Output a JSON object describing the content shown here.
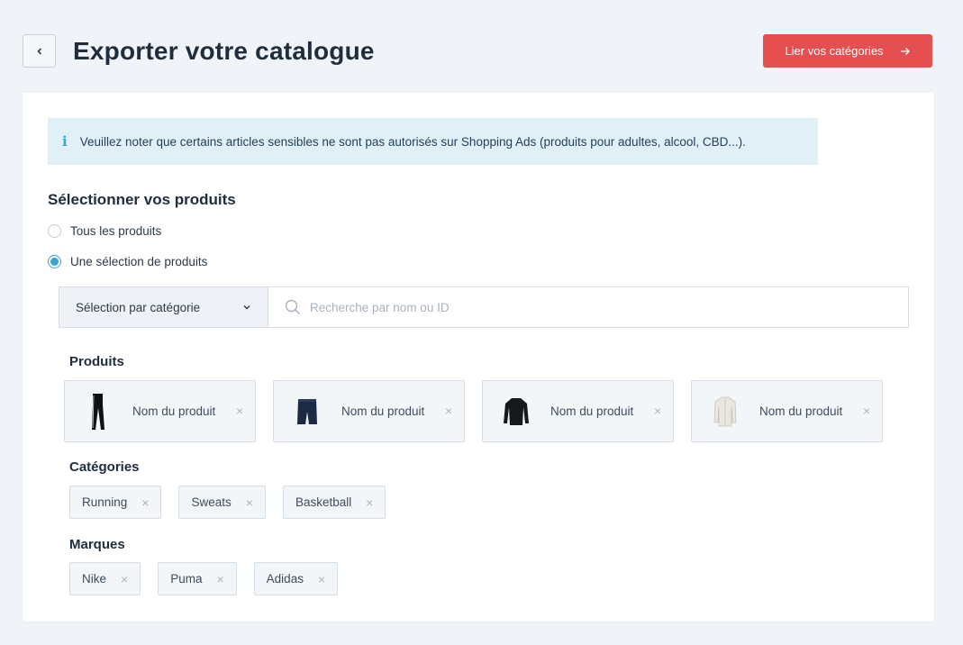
{
  "header": {
    "title": "Exporter votre catalogue",
    "primary_button": "Lier vos catégories"
  },
  "info": {
    "text": "Veuillez noter que certains articles sensibles ne sont pas autorisés sur Shopping Ads (produits pour adultes, alcool, CBD...)."
  },
  "selection": {
    "title": "Sélectionner vos produits",
    "options": [
      {
        "label": "Tous les produits",
        "checked": false
      },
      {
        "label": "Une sélection de produits",
        "checked": true
      }
    ]
  },
  "filter": {
    "select_value": "Sélection par catégorie",
    "search_placeholder": "Recherche par nom ou ID"
  },
  "products": {
    "title": "Produits",
    "items": [
      {
        "name": "Nom du produit",
        "image": "leggings"
      },
      {
        "name": "Nom du produit",
        "image": "shorts"
      },
      {
        "name": "Nom du produit",
        "image": "long-sleeve-top"
      },
      {
        "name": "Nom du produit",
        "image": "jacket"
      }
    ]
  },
  "categories": {
    "title": "Catégories",
    "items": [
      "Running",
      "Sweats",
      "Basketball"
    ]
  },
  "brands": {
    "title": "Marques",
    "items": [
      "Nike",
      "Puma",
      "Adidas"
    ]
  },
  "colors": {
    "accent": "#e54f4f",
    "info_bg": "#e1f0f6",
    "radio": "#3aa3cf"
  }
}
